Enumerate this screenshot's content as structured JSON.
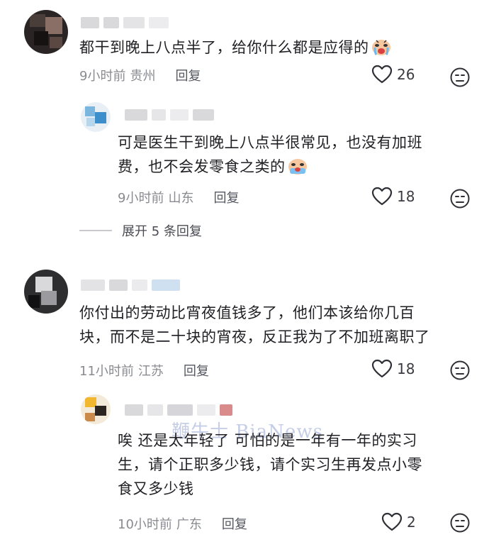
{
  "comments": [
    {
      "text": "都干到晚上八点半了，给你什么都是应得的",
      "time": "9小时前",
      "location": "贵州",
      "reply_label": "回复",
      "likes": "26"
    },
    {
      "text_line1": "可是医生干到晚上八点半很常见，也没有加班",
      "text_line2": "费，也不会发零食之类的",
      "time": "9小时前",
      "location": "山东",
      "reply_label": "回复",
      "likes": "18"
    },
    {
      "text_line1": "你付出的劳动比宵夜值钱多了，他们本该给你几百",
      "text_line2": "块，而不是二十块的宵夜，反正我为了不加班离职了",
      "time": "11小时前",
      "location": "江苏",
      "reply_label": "回复",
      "likes": "18"
    },
    {
      "text_line1": "唉 还是太年轻了 可怕的是一年有一年的实习",
      "text_line2": "生，请个正职多少钱，请个实习生再发点小零",
      "text_line3": "食又多少钱",
      "time": "10小时前",
      "location": "广东",
      "reply_label": "回复",
      "likes": "2"
    }
  ],
  "expand_replies": "展开 5 条回复",
  "watermark": "鞭牛士 BiaNews",
  "colors": {
    "text": "#1f1f24",
    "meta": "#8a8b91",
    "reply": "#555760",
    "background": "#ffffff"
  },
  "icons": [
    "heart-outline-icon",
    "dislike-face-icon",
    "crying-emoji-icon"
  ]
}
